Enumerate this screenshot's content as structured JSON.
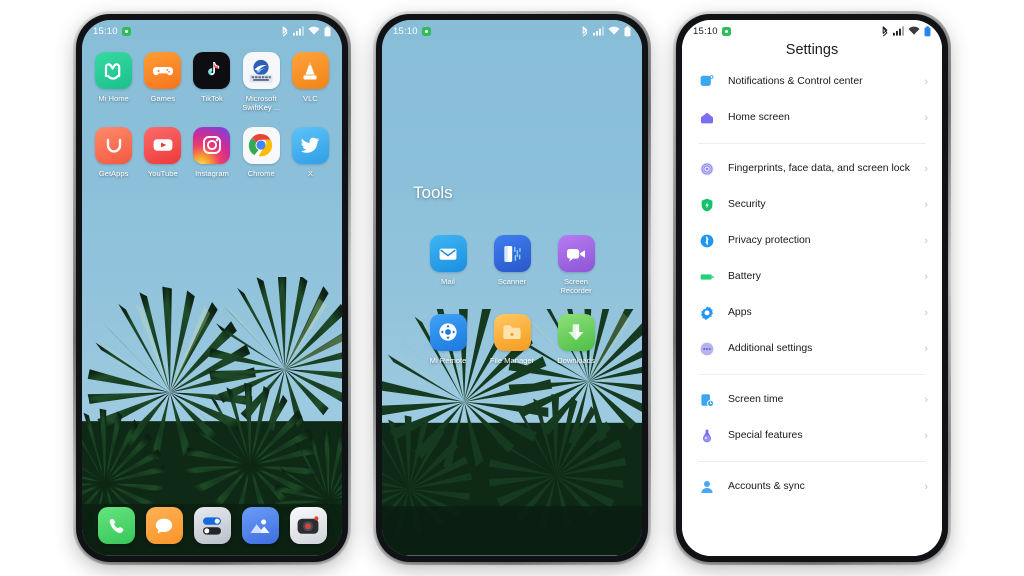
{
  "status_bar": {
    "time": "15:10",
    "badge_icon": "green-app-badge-icon",
    "icons": [
      "bluetooth-icon",
      "signal-bars-icon",
      "wifi-icon",
      "battery-icon"
    ]
  },
  "phone1": {
    "name": "home-screen",
    "apps_row1": [
      {
        "label": "Mi Home",
        "icon": "mi-home-icon"
      },
      {
        "label": "Games",
        "icon": "games-icon"
      },
      {
        "label": "TikTok",
        "icon": "tiktok-icon"
      },
      {
        "label": "Microsoft SwiftKey ...",
        "icon": "microsoft-swiftkey-icon"
      },
      {
        "label": "VLC",
        "icon": "vlc-icon"
      }
    ],
    "apps_row2": [
      {
        "label": "GetApps",
        "icon": "getapps-icon"
      },
      {
        "label": "YouTube",
        "icon": "youtube-icon"
      },
      {
        "label": "Instagram",
        "icon": "instagram-icon"
      },
      {
        "label": "Chrome",
        "icon": "chrome-icon"
      },
      {
        "label": "X",
        "icon": "x-twitter-icon"
      }
    ],
    "dock": [
      {
        "label": "Phone",
        "icon": "phone-icon"
      },
      {
        "label": "Messages",
        "icon": "messages-icon"
      },
      {
        "label": "Settings",
        "icon": "settings-toggles-icon"
      },
      {
        "label": "Gallery",
        "icon": "gallery-icon"
      },
      {
        "label": "Camera",
        "icon": "camera-icon"
      }
    ]
  },
  "phone2": {
    "name": "folder-screen",
    "folder_title": "Tools",
    "apps": [
      {
        "label": "Mail",
        "icon": "mail-icon"
      },
      {
        "label": "Scanner",
        "icon": "scanner-icon"
      },
      {
        "label": "Screen Recorder",
        "icon": "screen-recorder-icon"
      },
      {
        "label": "Mi Remote",
        "icon": "mi-remote-icon"
      },
      {
        "label": "File Manager",
        "icon": "file-manager-icon"
      },
      {
        "label": "Downloads",
        "icon": "downloads-icon"
      }
    ]
  },
  "phone3": {
    "name": "settings-screen",
    "title": "Settings",
    "groups": [
      {
        "rows": [
          {
            "label": "Notifications & Control center",
            "icon": "notifications-icon",
            "color": "#3ba7f0"
          },
          {
            "label": "Home screen",
            "icon": "home-icon",
            "color": "#7a6ff0"
          }
        ]
      },
      {
        "rows": [
          {
            "label": "Fingerprints, face data, and screen lock",
            "icon": "fingerprint-icon",
            "color": "#8f86ef"
          },
          {
            "label": "Security",
            "icon": "shield-icon",
            "color": "#13c26b"
          },
          {
            "label": "Privacy protection",
            "icon": "privacy-icon",
            "color": "#2196f3"
          },
          {
            "label": "Battery",
            "icon": "battery-settings-icon",
            "color": "#26d07c"
          },
          {
            "label": "Apps",
            "icon": "apps-gear-icon",
            "color": "#2196f3"
          },
          {
            "label": "Additional settings",
            "icon": "additional-settings-icon",
            "color": "#9b96e8"
          }
        ]
      },
      {
        "rows": [
          {
            "label": "Screen time",
            "icon": "screen-time-icon",
            "color": "#3ba7f0"
          },
          {
            "label": "Special features",
            "icon": "special-features-icon",
            "color": "#7a6ff0"
          }
        ]
      },
      {
        "rows": [
          {
            "label": "Accounts & sync",
            "icon": "accounts-sync-icon",
            "color": "#47a8f5"
          }
        ]
      }
    ],
    "chevron": "›"
  }
}
